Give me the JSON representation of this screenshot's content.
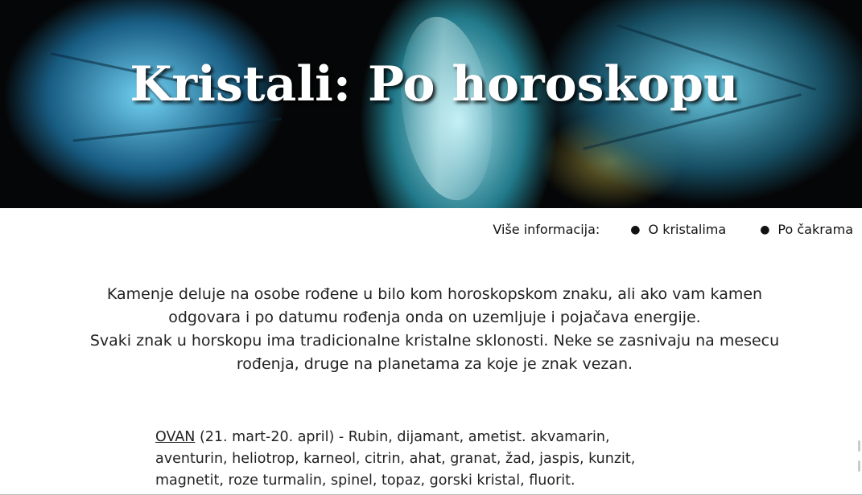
{
  "header": {
    "title": "Kristali: Po horoskopu",
    "banner_image": "labradorite-crystals-photo"
  },
  "nav": {
    "label": "Više informacija:",
    "links": [
      "O kristalima",
      "Po čakrama"
    ],
    "bullet_icon": "bullet-icon"
  },
  "intro": {
    "paragraph1": "Kamenje deluje na osobe rođene u bilo kom horoskopskom znaku, ali ako vam kamen odgovara i po datumu rođenja onda on uzemljuje i pojačava energije.",
    "paragraph2": "Svaki znak u horskopu ima tradicionalne kristalne sklonosti. Neke se zasnivaju na mesecu rođenja, druge na planetama za koje je znak vezan."
  },
  "signs": [
    {
      "name": "OVAN",
      "text": " (21. mart-20. april) - Rubin, dijamant, ametist. akvamarin, aventurin, heliotrop, karneol, citrin, ahat, granat, žad, jaspis, kunzit, magnetit, roze turmalin, spinel, topaz, gorski kristal, fluorit."
    }
  ]
}
